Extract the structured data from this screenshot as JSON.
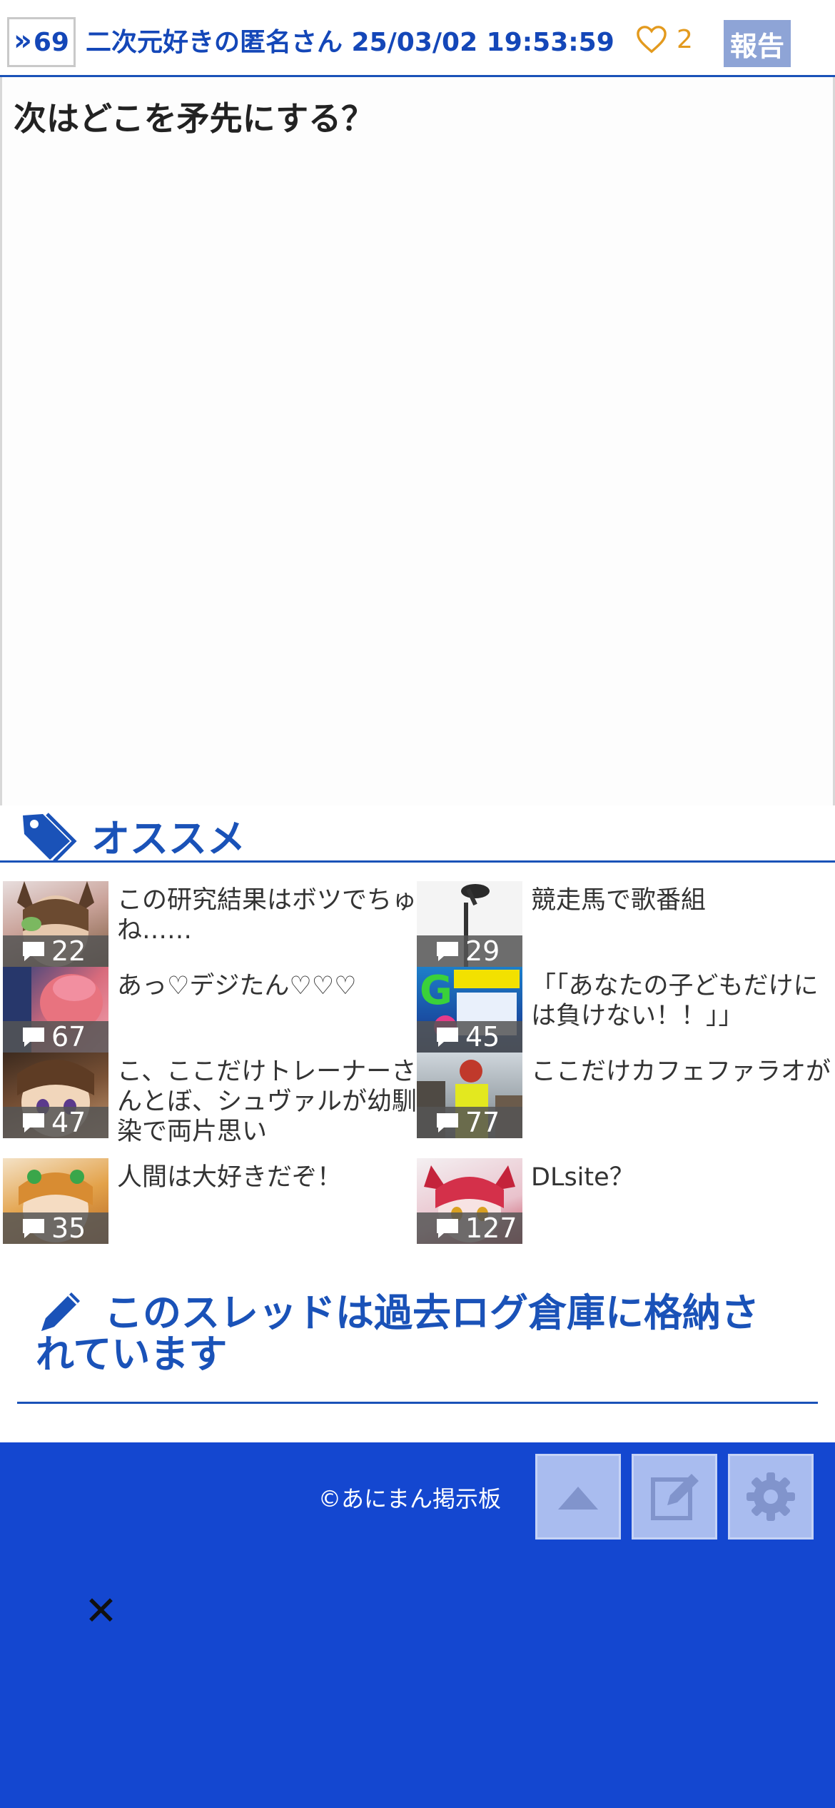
{
  "post": {
    "res_number": "69",
    "poster_line": "二次元好きの匿名さん 25/03/02 19:53:59",
    "like_count": "2",
    "report_label": "報告",
    "body": "次はどこを矛先にする？"
  },
  "recommend": {
    "title": "オススメ",
    "items": [
      {
        "text": "この研究結果はボツでちゅね……",
        "comments": "22"
      },
      {
        "text": "競走馬で歌番組",
        "comments": "29"
      },
      {
        "text": "あっ♡デジたん♡♡♡",
        "comments": "67"
      },
      {
        "text": "「「あなたの子どもだけには負けない！！」」",
        "comments": "45"
      },
      {
        "text": "こ、ここだけトレーナーさんとぼ、シュヴァルが幼馴染で両片思い",
        "comments": "47"
      },
      {
        "text": "ここだけカフェファラオが",
        "comments": "77"
      },
      {
        "text": "人間は大好きだぞ！",
        "comments": "35"
      },
      {
        "text": "DLsite？",
        "comments": "127"
      }
    ]
  },
  "archived_notice": "このスレッドは過去ログ倉庫に格納されています",
  "footer": {
    "copyright": "©あにまん掲示板"
  },
  "colors": {
    "brand_blue": "#1a52b8",
    "footer_blue": "#1447d0",
    "like_orange": "#e39a1e",
    "report_bg": "#8ea4d6"
  }
}
